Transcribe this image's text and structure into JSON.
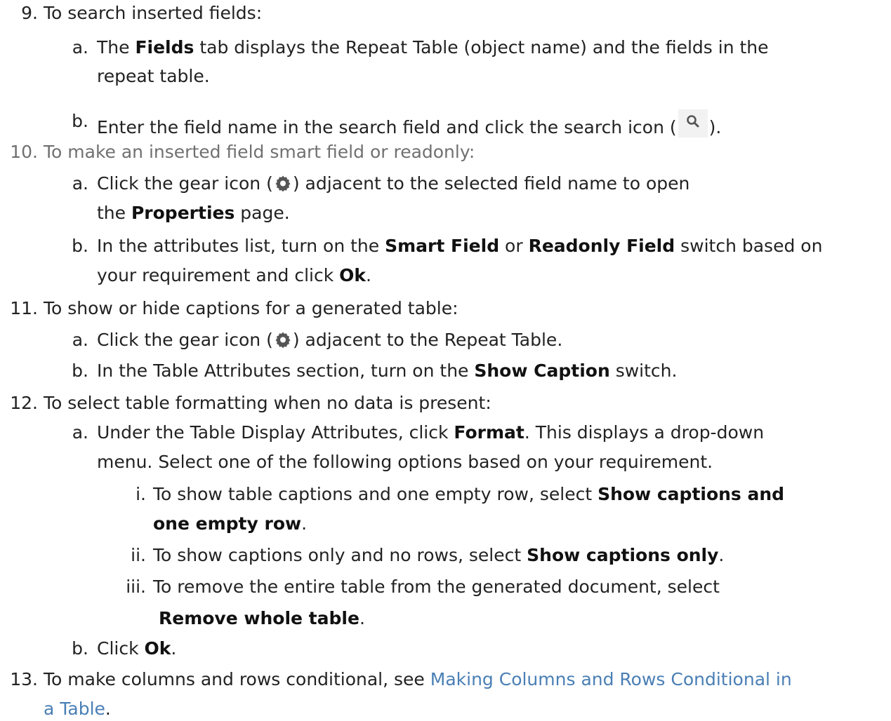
{
  "steps": {
    "s9": {
      "num": "9.",
      "text": "To search inserted fields:",
      "a": {
        "label": "a.",
        "t1": "The ",
        "b1": "Fields",
        "t2": " tab displays the Repeat Table (object name) and the fields in the",
        "t3": "repeat table."
      },
      "b": {
        "label": "b.",
        "t1": "Enter the field name in the search field and click the search icon (",
        "t2": ")."
      }
    },
    "s10": {
      "num": "10.",
      "text": "To make an inserted field smart field or readonly:",
      "a": {
        "label": "a.",
        "t1": "Click the gear icon (",
        "t2": ") adjacent to the selected field name to open",
        "t3": "the ",
        "b1": "Properties",
        "t4": " page."
      },
      "b": {
        "label": "b.",
        "t1": "In the attributes list, turn on the ",
        "b1": "Smart Field",
        "t2": " or ",
        "b2": "Readonly Field",
        "t3": " switch based on",
        "t4": "your requirement and click ",
        "b3": "Ok",
        "t5": "."
      }
    },
    "s11": {
      "num": "11.",
      "text": "To show or hide captions for a generated table:",
      "a": {
        "label": "a.",
        "t1": "Click the gear icon (",
        "t2": ") adjacent to the Repeat Table."
      },
      "b": {
        "label": "b.",
        "t1": "In the Table Attributes section, turn on the ",
        "b1": "Show Caption",
        "t2": " switch."
      }
    },
    "s12": {
      "num": "12.",
      "text": "To select table formatting when no data is present:",
      "a": {
        "label": "a.",
        "t1": "Under the Table Display Attributes, click ",
        "b1": "Format",
        "t2": ". This displays a drop-down",
        "t3": "menu. Select one of the following options based on your requirement."
      },
      "i": {
        "label": "i.",
        "t1": "To show table captions and one empty row, select ",
        "b1": "Show captions and",
        "b2": "one empty row",
        "t2": "."
      },
      "ii": {
        "label": "ii.",
        "t1": "To show captions only and no rows, select ",
        "b1": "Show captions only",
        "t2": "."
      },
      "iii": {
        "label": "iii.",
        "t1": "To remove the entire table from the generated document, select",
        "b1": "Remove whole table",
        "t2": "."
      },
      "b": {
        "label": "b.",
        "t1": "Click ",
        "b1": "Ok",
        "t2": "."
      }
    },
    "s13": {
      "num": "13.",
      "t1": "To make columns and rows conditional, see ",
      "link1": "Making Columns and Rows Conditional in",
      "link2": "a Table",
      "t2": "."
    }
  },
  "icons": {
    "search": "search-icon",
    "gear": "gear-icon"
  },
  "colors": {
    "text": "#222222",
    "muted": "#707070",
    "link": "#4a7fb5",
    "icon": "#555555"
  }
}
